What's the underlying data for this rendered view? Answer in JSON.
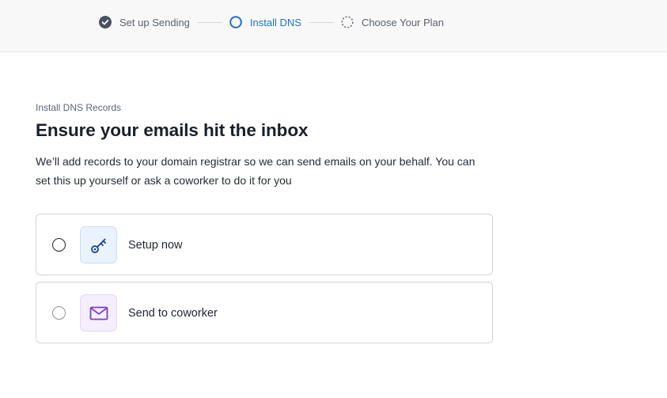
{
  "stepper": {
    "steps": [
      {
        "label": "Set up Sending",
        "state": "complete"
      },
      {
        "label": "Install DNS",
        "state": "active"
      },
      {
        "label": "Choose Your Plan",
        "state": "pending"
      }
    ]
  },
  "main": {
    "eyebrow": "Install DNS Records",
    "heading": "Ensure your emails hit the inbox",
    "description": "We’ll add records to your domain registrar so we can send emails on your behalf. You can set this up yourself or ask a coworker to do it for you"
  },
  "options": [
    {
      "label": "Setup now",
      "icon": "key-icon",
      "accent": "#1e3f8f",
      "selected": false
    },
    {
      "label": "Send to coworker",
      "icon": "mail-icon",
      "accent": "#7b3fc6",
      "selected": false
    }
  ],
  "colors": {
    "active_step": "#1f6fd1",
    "complete_step": "#4a5261"
  }
}
